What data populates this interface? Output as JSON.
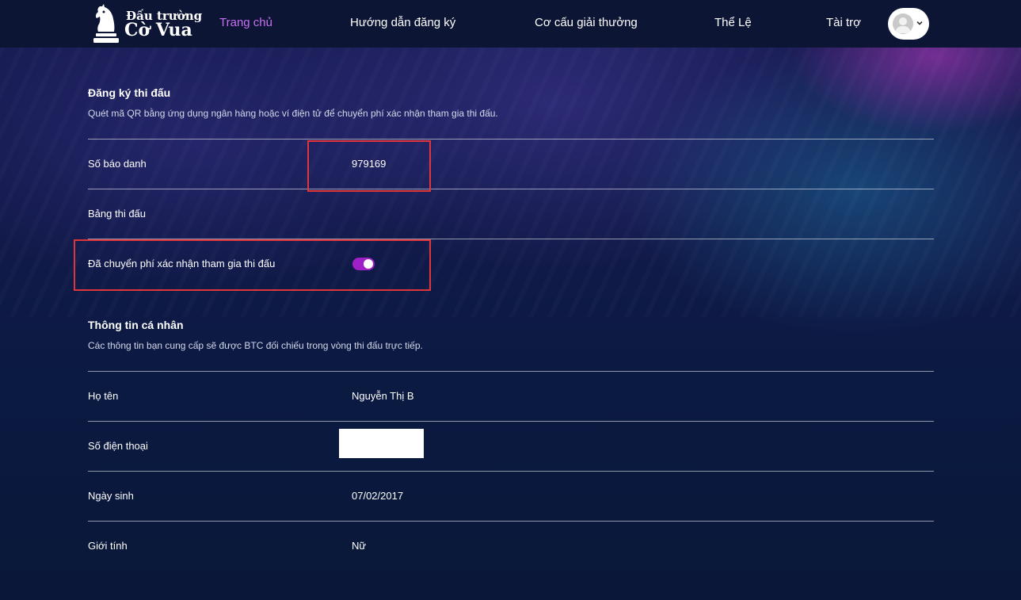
{
  "header": {
    "logo": {
      "line1": "Đấu trường",
      "line2": "Cờ Vua"
    },
    "nav": [
      {
        "label": "Trang chủ",
        "active": true
      },
      {
        "label": "Hướng dẫn đăng ký",
        "active": false
      },
      {
        "label": "Cơ cấu giải thưởng",
        "active": false
      },
      {
        "label": "Thể Lệ",
        "active": false
      },
      {
        "label": "Tài trợ",
        "active": false
      }
    ],
    "avatar_icon": "user-avatar-icon",
    "dropdown_icon": "chevron-down-icon"
  },
  "registration": {
    "title": "Đăng ký thi đấu",
    "description": "Quét mã QR bằng ứng dụng ngân hàng hoặc ví điện tử để chuyển phí xác nhận tham gia thi đấu.",
    "rows": [
      {
        "label": "Số báo danh",
        "value": "979169"
      },
      {
        "label": "Bảng thi đấu",
        "value": ""
      },
      {
        "label": "Đã chuyển phí xác nhận tham gia thi đấu",
        "toggle_on": true
      }
    ]
  },
  "personal": {
    "title": "Thông tin cá nhân",
    "description": "Các thông tin bạn cung cấp sẽ được BTC đối chiếu trong vòng thi đấu trực tiếp.",
    "rows": [
      {
        "label": "Họ tên",
        "value": "Nguyễn Thị B"
      },
      {
        "label": "Số điện thoại",
        "value": ""
      },
      {
        "label": "Ngày sinh",
        "value": "07/02/2017"
      },
      {
        "label": "Giới tính",
        "value": "Nữ"
      }
    ]
  },
  "colors": {
    "accent": "#c86ef0",
    "toggle_on": "#a020c8",
    "highlight": "#e0353b",
    "header_bg": "#0c1533"
  }
}
